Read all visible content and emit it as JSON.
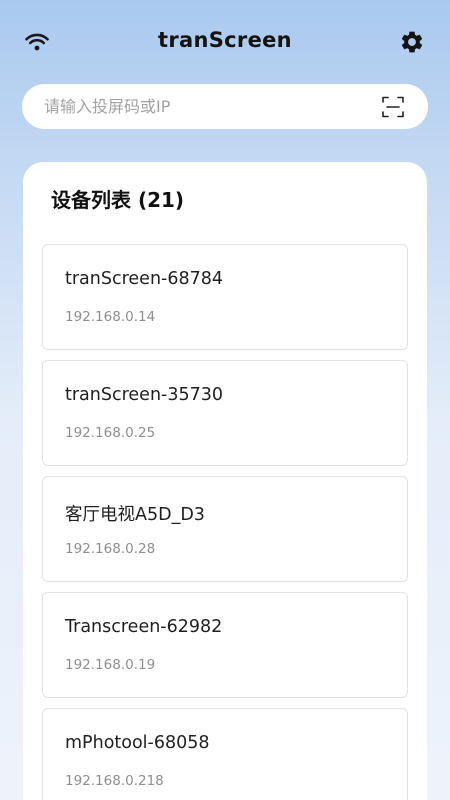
{
  "header": {
    "title": "tranScreen",
    "wifi_icon": "wifi-icon",
    "settings_icon": "gear-icon"
  },
  "search": {
    "placeholder": "请输入投屏码或IP",
    "value": "",
    "scan_icon": "scan-icon"
  },
  "device_list": {
    "title": "设备列表 (21)",
    "devices": [
      {
        "name": "tranScreen-68784",
        "ip": "192.168.0.14"
      },
      {
        "name": "tranScreen-35730",
        "ip": "192.168.0.25"
      },
      {
        "name": "客厅电视A5D_D3",
        "ip": "192.168.0.28"
      },
      {
        "name": "Transcreen-62982",
        "ip": "192.168.0.19"
      },
      {
        "name": "mPhotool-68058",
        "ip": "192.168.0.218"
      }
    ]
  },
  "colors": {
    "background_top": "#a9c9ef",
    "background_bottom": "#eef3fb",
    "card_border": "#e2e2e2",
    "ip_text": "#8e8e8e"
  }
}
